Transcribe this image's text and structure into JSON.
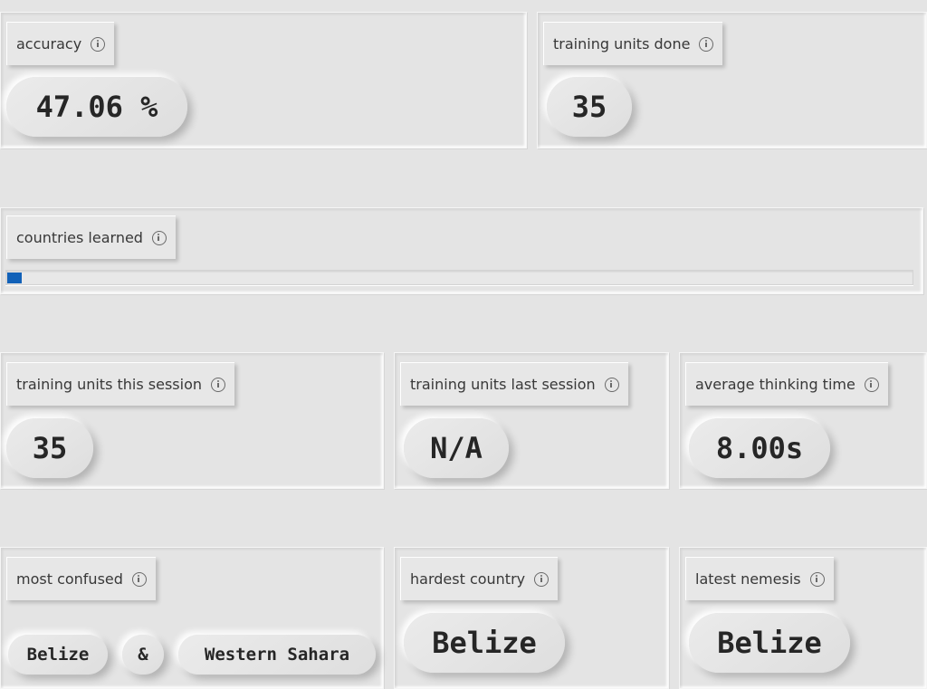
{
  "stats": {
    "accuracy": {
      "label": "accuracy",
      "value": "47.06 %"
    },
    "training_units_done": {
      "label": "training units done",
      "value": "35"
    },
    "countries_learned": {
      "label": "countries learned",
      "progress_fraction": 0.016,
      "fill_color": "#1161b8"
    },
    "training_units_this_session": {
      "label": "training units this session",
      "value": "35"
    },
    "training_units_last_session": {
      "label": "training units last session",
      "value": "N/A"
    },
    "average_thinking_time": {
      "label": "average thinking time",
      "value": "8.00s"
    },
    "most_confused": {
      "label": "most confused",
      "country_a": "Belize",
      "joiner": "&",
      "country_b": "Western Sahara"
    },
    "hardest_country": {
      "label": "hardest country",
      "value": "Belize"
    },
    "latest_nemesis": {
      "label": "latest nemesis",
      "value": "Belize"
    }
  },
  "icons": {
    "info": "info-icon"
  }
}
